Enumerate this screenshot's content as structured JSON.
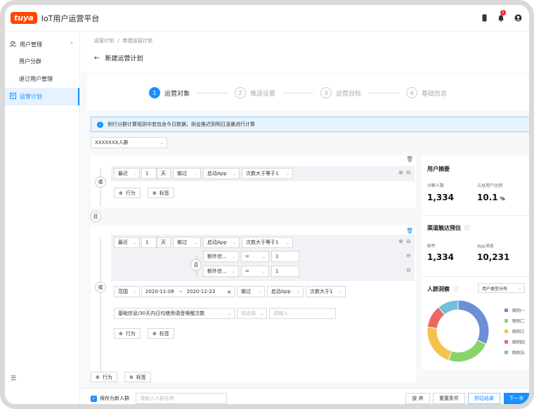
{
  "app": {
    "logo": "tuya",
    "title": "IoT用户运营平台"
  },
  "sidebar": {
    "group_label": "用户管理",
    "items": [
      "用户分群",
      "退订用户管理"
    ],
    "active_item": "运营计划"
  },
  "breadcrumb": {
    "parent": "运营计划",
    "sep": "/",
    "current": "新建运营计划"
  },
  "page_title": "新建运营计划",
  "badge_count": "1",
  "steps": [
    {
      "num": "1",
      "label": "运营对象"
    },
    {
      "num": "2",
      "label": "推送设置"
    },
    {
      "num": "3",
      "label": "运营目标"
    },
    {
      "num": "4",
      "label": "基础信息"
    }
  ],
  "notice": "例行分群计算规则中若包含今日数据，则会推迟到明日凌晨进行计算",
  "group_select": "XXXXXXX人群",
  "logic": {
    "or": "或",
    "and": "且"
  },
  "block1": {
    "row": [
      "最近",
      "1",
      "天",
      "做过",
      "启动App",
      "次数大于等于1"
    ],
    "add_behavior": "行为",
    "add_tag": "标签"
  },
  "block2": {
    "row": [
      "最近",
      "1",
      "天",
      "做过",
      "启动App",
      "次数大于等于1"
    ],
    "sub1": [
      "额外信...",
      "=",
      "1"
    ],
    "sub2": [
      "额外信...",
      "=",
      "1"
    ],
    "row2": [
      "范围",
      "2020-11-08",
      "→",
      "2020-12-23",
      "做过",
      "启动App",
      "次数大于1"
    ],
    "row3": {
      "field": "基础信息/30天内日均使用语音唤醒次数",
      "op_placeholder": "请选择",
      "val_placeholder": "请输入"
    },
    "add_behavior": "行为",
    "add_tag": "标签"
  },
  "bottom_add": {
    "behavior": "行为",
    "tag": "标签"
  },
  "summary": {
    "title": "用户摘要",
    "count_label": "分群人数",
    "count": "1,334",
    "ratio_label": "占总用户比例",
    "ratio": "10.1",
    "ratio_unit": "%"
  },
  "reach": {
    "title": "渠道触达预估",
    "mail_label": "邮件",
    "mail": "1,334",
    "app_label": "App消息",
    "app": "10,231"
  },
  "insight": {
    "title": "人群洞察",
    "select": "用户类型分布",
    "legend": [
      "图例一",
      "图例二",
      "图例三",
      "图例四",
      "图例五"
    ]
  },
  "chart_data": {
    "type": "pie",
    "categories": [
      "图例一",
      "图例二",
      "图例三",
      "图例四",
      "图例五"
    ],
    "values": [
      32,
      23,
      22,
      12,
      11
    ],
    "colors": [
      "#6c8fd8",
      "#8bd36b",
      "#f5c24c",
      "#ee6666",
      "#73c0de"
    ]
  },
  "footer": {
    "save_new": "保存为新人群",
    "name_placeholder": "请输入人群名称",
    "cancel": "放 弃",
    "reset": "重置条件",
    "estimate": "预估结果",
    "next": "下一步"
  }
}
